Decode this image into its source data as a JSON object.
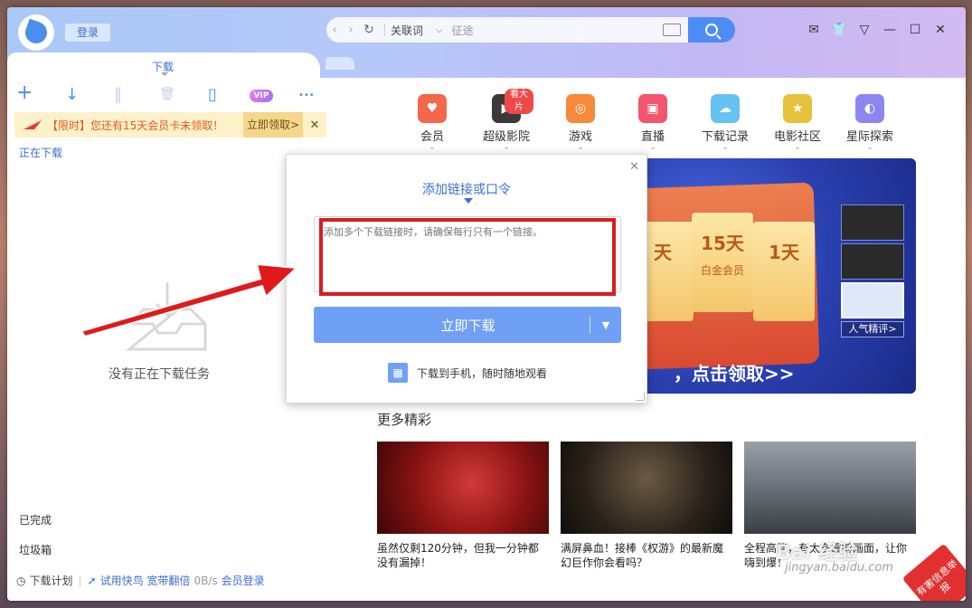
{
  "header": {
    "login_label": "登录",
    "address": {
      "back": "‹",
      "forward": "›",
      "refresh": "↻",
      "keyword_label": "关联词",
      "caret": "⌵",
      "placeholder": "征途"
    },
    "window_controls": [
      "✉",
      "👕",
      "▽",
      "—",
      "☐",
      "✕"
    ]
  },
  "tabs": {
    "active_label": "下载"
  },
  "toolbar": {
    "add": "+",
    "download": "↓",
    "pause": "‖",
    "delete": "🗑",
    "phone": "▯",
    "vip": "VIP",
    "more": "•••"
  },
  "promo": {
    "text": "【限时】您还有15天会员卡未领取！",
    "claim_label": "立即领取>",
    "close": "✕"
  },
  "left": {
    "downloading_label": "正在下载",
    "empty_text": "没有正在下载任务",
    "done_label": "已完成",
    "trash_label": "垃圾箱"
  },
  "footer": {
    "plan": "下载计划",
    "trial": "试用快鸟 宽带翻倍",
    "speed": "0B/s",
    "member_login": "会员登录"
  },
  "nav": {
    "items": [
      {
        "label": "会员",
        "color": "#f4674a",
        "glyph": "♥"
      },
      {
        "label": "超级影院",
        "color": "#3a3a3a",
        "glyph": "▶",
        "badge": "看大片"
      },
      {
        "label": "游戏",
        "color": "#f7893a",
        "glyph": "◎"
      },
      {
        "label": "直播",
        "color": "#f3556c",
        "glyph": "▣"
      },
      {
        "label": "下载记录",
        "color": "#66c2f0",
        "glyph": "☁"
      },
      {
        "label": "电影社区",
        "color": "#e6c23a",
        "glyph": "★"
      },
      {
        "label": "星际探索",
        "color": "#8e86f0",
        "glyph": "◐"
      }
    ]
  },
  "banner": {
    "ticket_left": "天",
    "ticket_center_big": "15天",
    "ticket_center_sm": "白金会员",
    "ticket_right": "1天",
    "cta": "，点击领取>>",
    "thumb_label": "人气精评>"
  },
  "more": {
    "title": "更多精彩",
    "cards": [
      {
        "text": "虽然仅剩120分钟，但我一分钟都没有漏掉！"
      },
      {
        "text": "满屏鼻血！接棒《权游》的最新魔幻巨作你会看吗？"
      },
      {
        "text": "全程高能，有太多震撼画面，让你嗨到爆！"
      }
    ]
  },
  "popup": {
    "close": "✕",
    "title": "添加链接或口令",
    "placeholder": "添加多个下载链接时，请确保每行只有一个链接。",
    "download_label": "立即下载",
    "caret": "▼",
    "phone_text": "下载到手机，随时随地观看"
  },
  "corner_badge": "有害信息举报",
  "watermark": "Bai 经验",
  "watermark_sub": "jingyan.baidu.com"
}
